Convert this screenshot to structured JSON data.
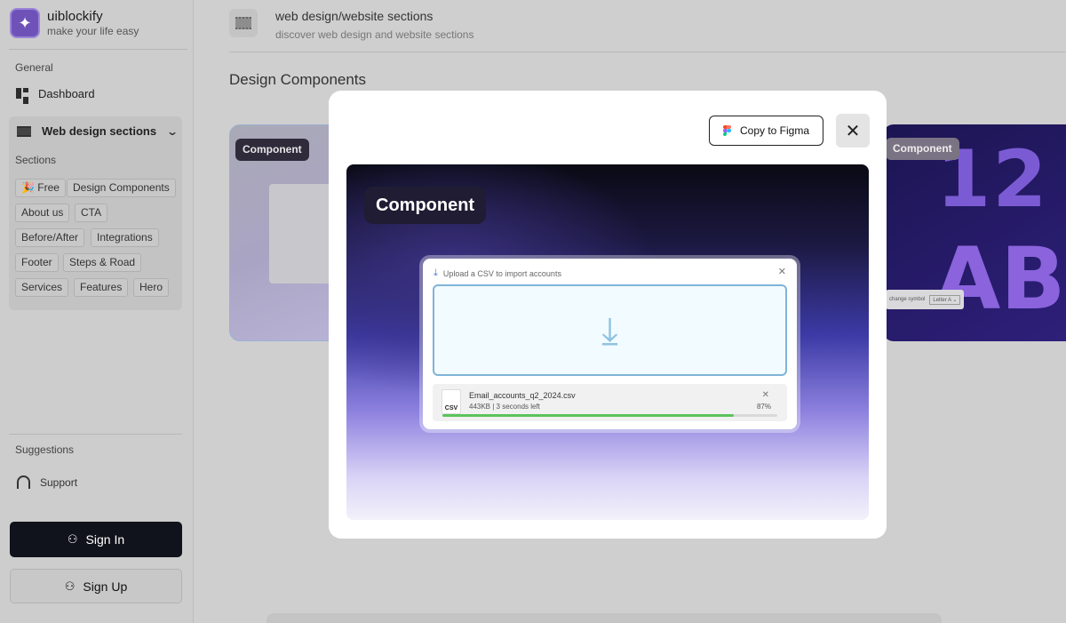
{
  "brand": {
    "logo_glyph": "✦",
    "name": "uiblockify",
    "tagline": "make your life easy",
    "accent": "#6f52b8"
  },
  "sidebar": {
    "general_label": "General",
    "dashboard_label": "Dashboard",
    "web_design_label": "Web design sections",
    "sections_label": "Sections",
    "chips": [
      "🎉 Free",
      "Design Components",
      "About us",
      "CTA",
      "Before/After",
      "Integrations",
      "Footer",
      "Steps & Road",
      "Services",
      "Features",
      "Hero"
    ],
    "suggestions_label": "Suggestions",
    "support_label": "Support",
    "sign_in": "Sign In",
    "sign_up": "Sign Up"
  },
  "main": {
    "title": "web design/website sections",
    "subtitle": "discover web design and website sections",
    "section_title": "Design Components",
    "card_badge_left": "Component",
    "card_badge_right": "Component",
    "right_card_digits": "12",
    "right_card_letters": "AB",
    "symbol_label": "change symbol",
    "symbol_value": "Letter A ⌄"
  },
  "modal": {
    "copy_button": "Copy to Figma",
    "close_glyph": "✕",
    "preview_badge": "Component",
    "upload_title": "Upload a CSV to import accounts",
    "upload_close": "✕",
    "file_icon_label": "CSV",
    "file_name": "Email_accounts_q2_2024.csv",
    "file_meta": "443KB | 3 seconds left",
    "file_close": "✕",
    "progress_label": "87%",
    "progress_fraction": 0.87
  }
}
